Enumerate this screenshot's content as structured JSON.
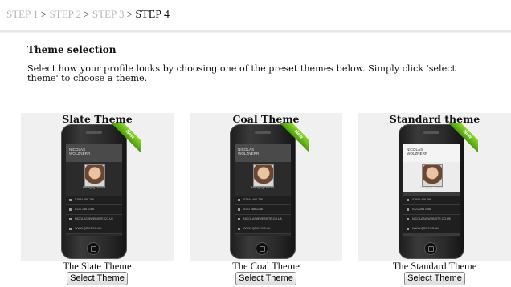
{
  "steps": [
    {
      "label": "STEP 1",
      "state": "inactive"
    },
    {
      "label": "STEP 2",
      "state": "inactive"
    },
    {
      "label": "STEP 3",
      "state": "inactive"
    },
    {
      "label": "STEP 4",
      "state": "active"
    }
  ],
  "step_separator": ">",
  "section": {
    "heading": "Theme selection",
    "intro": "Select how your profile looks by choosing one of the preset themes below. Simply click 'select theme' to choose a theme."
  },
  "themes": [
    {
      "title": "Slate Theme",
      "caption": "The Slate Theme",
      "button": "Select Theme"
    },
    {
      "title": "Coal Theme",
      "caption": "The Coal Theme",
      "button": "Select Theme"
    },
    {
      "title": "Standard theme",
      "caption": "The Standard Theme",
      "button": "Select Theme"
    }
  ],
  "phone_preview": {
    "ribbon": "New",
    "name_line1": "NICOLAS",
    "name_line2": "WOLZNERR",
    "subtitle": "Managing Director",
    "rows": [
      "07944 466 786",
      "0121 288 2288",
      "NICOLAS@WEBSITE.CO.UK",
      "WWW.QRMT.CO.UK"
    ]
  },
  "colors": {
    "inactive_step": "#b8b8b8",
    "panel": "#f0f0f0",
    "ribbon": "#6cbf1a"
  }
}
